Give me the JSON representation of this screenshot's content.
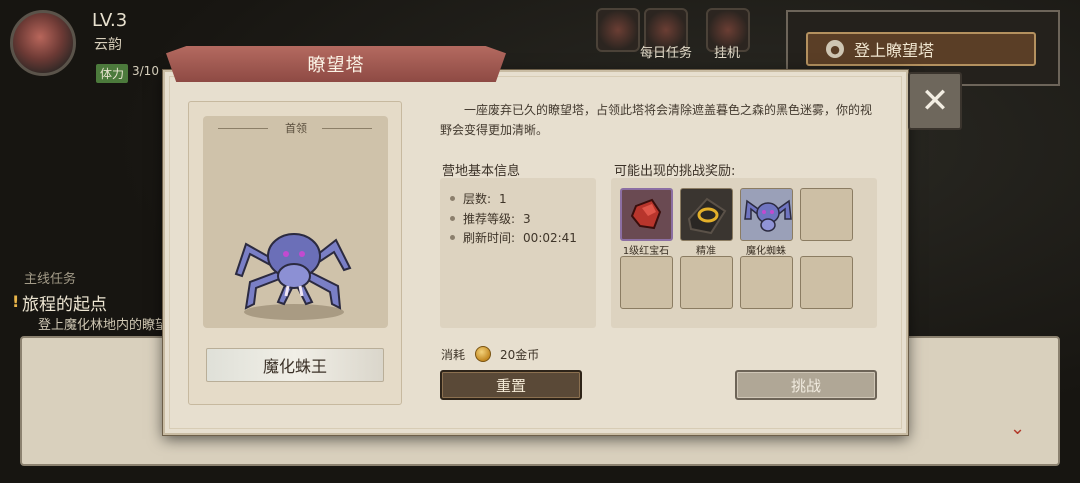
{
  "hud": {
    "level": "LV.3",
    "player_name": "云韵",
    "stamina_tag": "体力",
    "stamina_value": "3/10",
    "daily_task_label": "每日任务",
    "afk_label": "挂机",
    "climb_button": "登上瞭望塔"
  },
  "quest": {
    "section_label": "主线任务",
    "title": "旅程的起点",
    "description": "登上魔化林地内的瞭望塔"
  },
  "dialog": {
    "title": "瞭望塔",
    "close_symbol": "✕",
    "description": "一座废弃已久的瞭望塔，占领此塔将会清除遮盖暮色之森的黑色迷雾，你的视野会变得更加清晰。",
    "boss": {
      "tag": "首领",
      "name": "魔化蛛王"
    },
    "camp_info": {
      "title": "营地基本信息",
      "rows": [
        {
          "label": "层数:",
          "value": "1"
        },
        {
          "label": "推荐等级:",
          "value": "3"
        },
        {
          "label": "刷新时间:",
          "value": "00:02:41"
        }
      ]
    },
    "rewards": {
      "title": "可能出现的挑战奖励:",
      "items": [
        {
          "name": "1级红宝石",
          "icon": "ruby-icon"
        },
        {
          "name": "精准",
          "icon": "rune-icon"
        },
        {
          "name": "魔化蜘蛛",
          "icon": "spider-icon"
        }
      ],
      "total_slots": 8
    },
    "cost": {
      "label": "消耗",
      "value": "20金币"
    },
    "buttons": {
      "reset": "重置",
      "challenge": "挑战"
    }
  },
  "colors": {
    "ribbon": "#a35a52",
    "dialog_bg": "#e7dfcf",
    "reset_bg": "#5a4937",
    "challenge_bg": "#b0a796"
  }
}
